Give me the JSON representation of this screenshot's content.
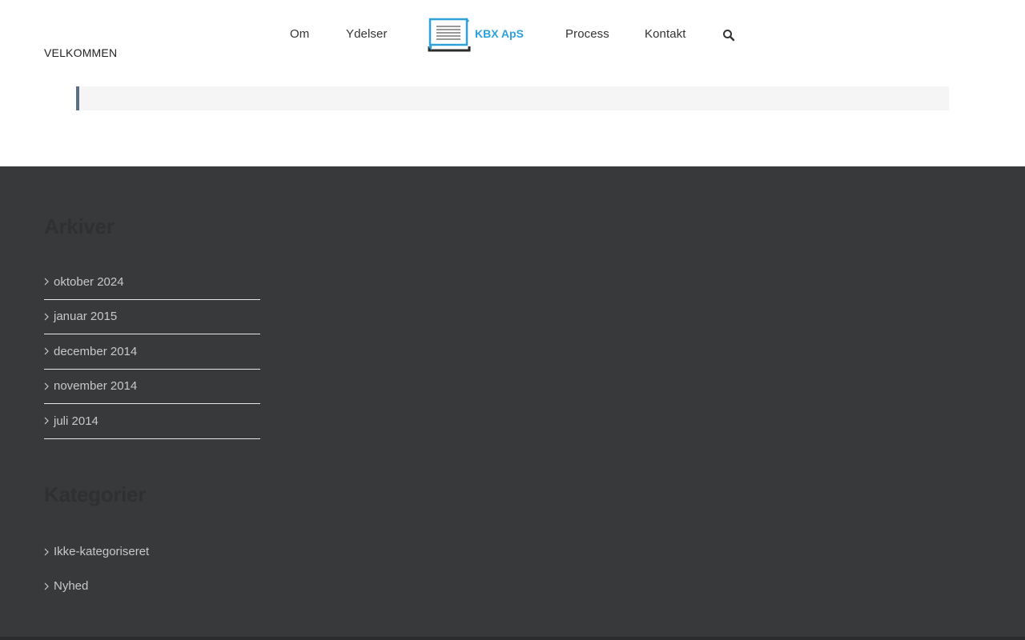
{
  "header": {
    "nav": {
      "om": "Om",
      "ydelser": "Ydelser",
      "process": "Process",
      "kontakt": "Kontakt"
    },
    "logo_text": "KBX ApS",
    "search_icon": "search-icon",
    "breadcrumb": "VELKOMMEN"
  },
  "footer": {
    "archives": {
      "title": "Arkiver",
      "items": [
        "oktober 2024",
        "januar 2015",
        "december 2014",
        "november 2014",
        "juli 2014"
      ]
    },
    "categories": {
      "title": "Kategorier",
      "items": [
        "Ikke-kategoriseret",
        "Nyhed"
      ]
    }
  },
  "colors": {
    "accent": "#2ea0dc",
    "footer_bg": "#38393b",
    "quote_border": "#5b6e86"
  }
}
